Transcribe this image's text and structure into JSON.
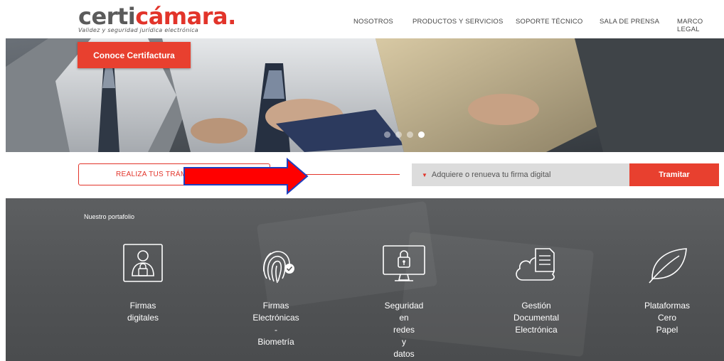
{
  "header": {
    "logo": {
      "part1": "certi",
      "part2": "cámara.",
      "tagline": "Validez y seguridad jurídica electrónica"
    },
    "nav": [
      "NOSOTROS",
      "PRODUCTOS Y SERVICIOS",
      "SOPORTE TÉCNICO",
      "SALA DE PRENSA",
      "MARCO LEGAL"
    ]
  },
  "hero": {
    "cta_label": "Conoce Certifactura",
    "slides_total": 4,
    "active_slide": 4
  },
  "tramites": {
    "box_label": "REALIZA TUS TRÁMIT",
    "select_value": "Adquiere o renueva tu firma digital",
    "submit_label": "Tramitar"
  },
  "portfolio": {
    "title": "Nuestro portafolio",
    "items": [
      {
        "icon": "user-lock-icon",
        "lines": [
          "Firmas",
          "digitales"
        ]
      },
      {
        "icon": "fingerprint-icon",
        "lines": [
          "Firmas",
          "Electrónicas",
          "-",
          "Biometría"
        ]
      },
      {
        "icon": "monitor-lock-icon",
        "lines": [
          "Seguridad",
          "en",
          "redes",
          "y",
          "datos"
        ]
      },
      {
        "icon": "cloud-document-icon",
        "lines": [
          "Gestión",
          "Documental",
          "Electrónica"
        ]
      },
      {
        "icon": "leaf-icon",
        "lines": [
          "Plataformas",
          "Cero",
          "Papel"
        ]
      }
    ]
  },
  "colors": {
    "brand_red": "#e2342a",
    "button_red": "#e8402f",
    "arrow_red": "#ff0000",
    "arrow_border": "#1f3fbf"
  }
}
